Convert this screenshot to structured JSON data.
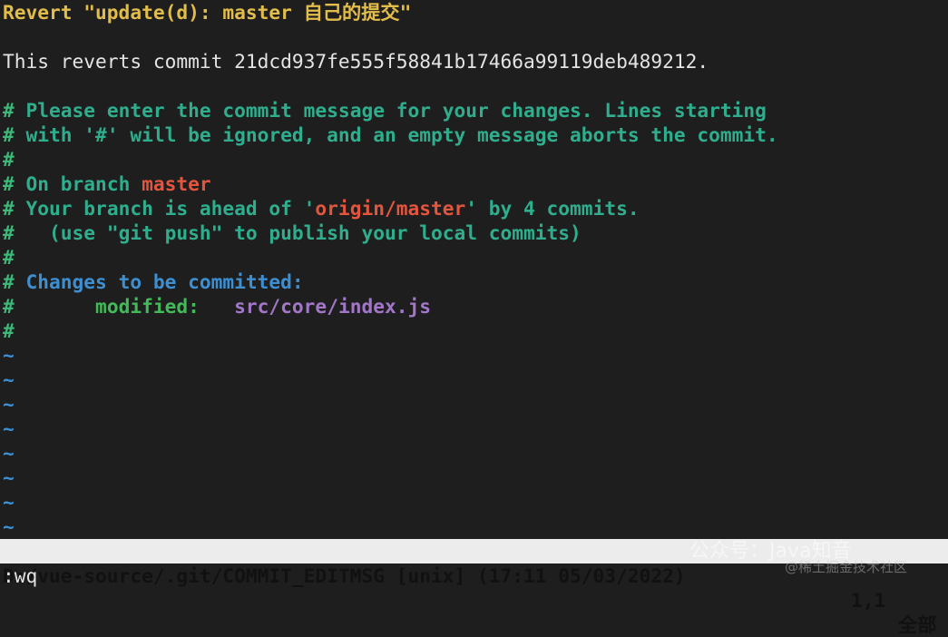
{
  "lines": [
    [
      {
        "t": "Revert \"update(d): master 自己的提交\"",
        "c": "yellow"
      }
    ],
    [],
    [
      {
        "t": "This reverts commit 21dcd937fe555f58841b17466a99119deb489212.",
        "c": "white"
      }
    ],
    [],
    [
      {
        "t": "#",
        "c": "hash"
      },
      {
        "t": " Please enter the commit message for your changes. Lines starting",
        "c": "teal"
      }
    ],
    [
      {
        "t": "#",
        "c": "hash"
      },
      {
        "t": " with '#' will be ignored, and an empty message aborts the commit.",
        "c": "teal"
      }
    ],
    [
      {
        "t": "#",
        "c": "hash"
      }
    ],
    [
      {
        "t": "#",
        "c": "hash"
      },
      {
        "t": " On branch ",
        "c": "teal"
      },
      {
        "t": "master",
        "c": "red"
      }
    ],
    [
      {
        "t": "#",
        "c": "hash"
      },
      {
        "t": " Your branch is ahead of '",
        "c": "teal"
      },
      {
        "t": "origin/master",
        "c": "red"
      },
      {
        "t": "' by 4 commits.",
        "c": "teal"
      }
    ],
    [
      {
        "t": "#",
        "c": "hash"
      },
      {
        "t": "   (use \"git push\" to publish your local commits)",
        "c": "teal"
      }
    ],
    [
      {
        "t": "#",
        "c": "hash"
      }
    ],
    [
      {
        "t": "#",
        "c": "hash"
      },
      {
        "t": " Changes to be committed:",
        "c": "blue"
      }
    ],
    [
      {
        "t": "#",
        "c": "hash"
      },
      {
        "t": "       modified:   ",
        "c": "green"
      },
      {
        "t": "src/core/index.js",
        "c": "purple"
      }
    ],
    [
      {
        "t": "#",
        "c": "hash"
      }
    ],
    [
      {
        "t": "~",
        "c": "tilde"
      }
    ],
    [
      {
        "t": "~",
        "c": "tilde"
      }
    ],
    [
      {
        "t": "~",
        "c": "tilde"
      }
    ],
    [
      {
        "t": "~",
        "c": "tilde"
      }
    ],
    [
      {
        "t": "~",
        "c": "tilde"
      }
    ],
    [
      {
        "t": "~",
        "c": "tilde"
      }
    ],
    [
      {
        "t": "~",
        "c": "tilde"
      }
    ],
    [
      {
        "t": "~",
        "c": "tilde"
      }
    ]
  ],
  "status": {
    "file": "D:/vue-source/.git/COMMIT_EDITMSG [unix] (17:11 05/03/2022)",
    "position": "1,1",
    "scroll": "全部"
  },
  "command": ":wq",
  "watermark": {
    "line1": "公众号：Java知音",
    "line2": "@稀土掘金技术社区"
  }
}
